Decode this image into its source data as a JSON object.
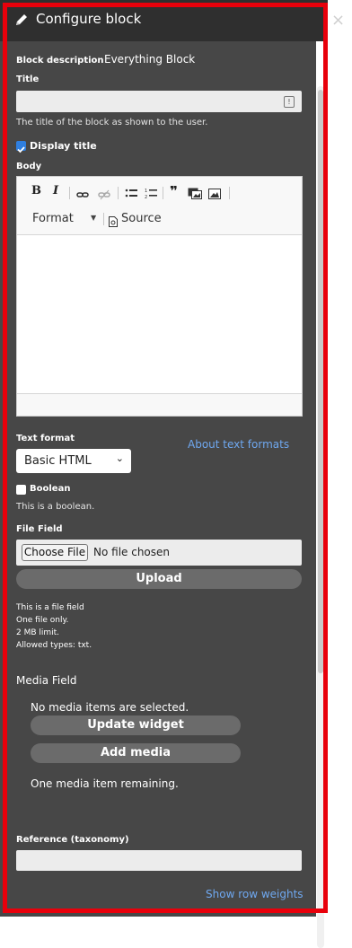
{
  "header": {
    "title": "Configure block",
    "close_symbol": "×"
  },
  "block_description": {
    "label": "Block description",
    "value": "Everything Block"
  },
  "title_field": {
    "label": "Title",
    "value": "",
    "help": "The title of the block as shown to the user."
  },
  "display_title": {
    "label": "Display title",
    "checked": true
  },
  "body": {
    "label": "Body",
    "toolbar": {
      "bold": "B",
      "italic": "I",
      "format_label": "Format",
      "source_label": "Source"
    }
  },
  "text_format": {
    "label": "Text format",
    "selected": "Basic HTML",
    "about_link": "About text formats"
  },
  "boolean": {
    "label": "Boolean",
    "checked": false,
    "help": "This is a boolean."
  },
  "file_field": {
    "label": "File Field",
    "choose_label": "Choose File",
    "status": "No file chosen",
    "upload_label": "Upload",
    "help": [
      "This is a file field",
      "One file only.",
      "2 MB limit.",
      "Allowed types: txt."
    ]
  },
  "media_field": {
    "label": "Media Field",
    "empty_text": "No media items are selected.",
    "update_label": "Update widget",
    "add_label": "Add media",
    "remaining": "One media item remaining."
  },
  "reference": {
    "label": "Reference (taxonomy)",
    "value": ""
  },
  "row_weights_link": "Show row weights",
  "colors": {
    "panel": "#474747",
    "header": "#2f2f2f",
    "outline": "#e8000b",
    "link": "#6fa8f0",
    "checkbox": "#2f7fe0"
  }
}
